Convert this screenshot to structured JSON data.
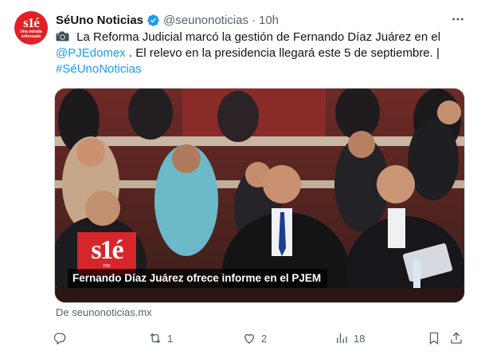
{
  "account": {
    "name": "SéUno Noticias",
    "handle": "@seunonoticias",
    "separator": "·",
    "time": "10h",
    "avatar_logo": "s1é",
    "avatar_tagline": "Una mirada informada"
  },
  "tweet": {
    "line1_text": " La Reforma Judicial marcó la gestión de Fernando Díaz Juárez en el",
    "line2_mention": "@PJEdomex",
    "line2_text": " . El relevo en la presidencia llegará este 5 de septiembre. |",
    "line3_hashtag": "#SéUnoNoticias"
  },
  "media": {
    "caption": "Fernando Díaz Juárez ofrece informe en el PJEM",
    "overlay_logo": "s1é",
    "overlay_sub": "mx"
  },
  "source": "De seunonoticias.mx",
  "actions": {
    "reply_count": "",
    "retweet_count": "1",
    "like_count": "2",
    "views_count": "18"
  },
  "colors": {
    "link": "#1d9bf0",
    "verified": "#1d9bf0",
    "brand_red": "#e31f26",
    "muted": "#536471"
  },
  "icons": [
    "camera-icon",
    "verified-badge-icon",
    "more-options-icon",
    "reply-icon",
    "retweet-icon",
    "like-icon",
    "views-icon",
    "bookmark-icon",
    "share-icon"
  ]
}
